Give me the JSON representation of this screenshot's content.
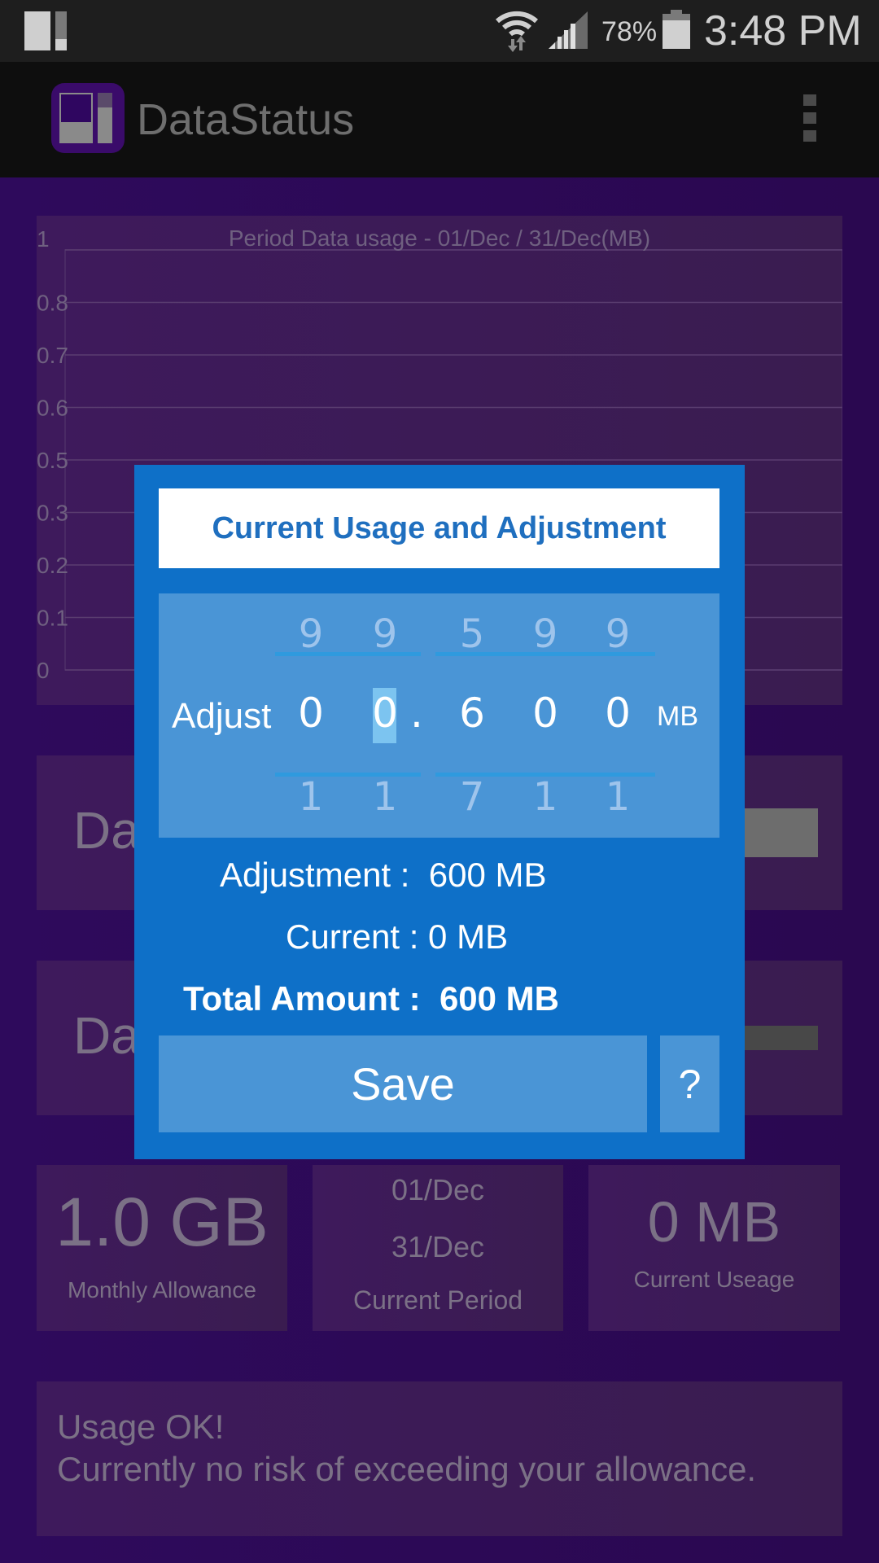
{
  "status_bar": {
    "battery_percent": "78%",
    "time": "3:48 PM",
    "icons": [
      "app-notification-icon",
      "wifi-icon",
      "signal-icon",
      "battery-icon"
    ]
  },
  "app_bar": {
    "title": "DataStatus",
    "overflow_icon": "more-vertical-icon"
  },
  "chart_data": {
    "type": "bar",
    "title": "Period Data usage - 01/Dec / 31/Dec(MB)",
    "ytick_labels": [
      "1",
      "0.8",
      "0.7",
      "0.6",
      "0.5",
      "0.3",
      "0.2",
      "0.1",
      "0"
    ],
    "ylim": [
      0,
      1
    ],
    "categories": [],
    "values": [],
    "grid": true,
    "xlabel": "",
    "ylabel": ""
  },
  "daily_cards": [
    {
      "label_partial": "Da",
      "bar_color": "#6d6d6d"
    },
    {
      "label_partial": "Da",
      "bar_color": "#484848"
    }
  ],
  "stats": [
    {
      "value": "1.0 GB",
      "label": "Monthly Allowance"
    },
    {
      "start": "01/Dec",
      "end": "31/Dec",
      "label": "Current Period"
    },
    {
      "value": "0 MB",
      "label": "Current Useage"
    }
  ],
  "message": {
    "line1": "Usage OK!",
    "line2": "Currently no risk of exceeding your allowance."
  },
  "dialog": {
    "title": "Current Usage and Adjustment",
    "adjust_label": "Adjust",
    "unit": "MB",
    "decimal": ".",
    "picker": {
      "above": [
        "9",
        "9",
        "5",
        "9",
        "9"
      ],
      "current": [
        "0",
        "0",
        "6",
        "0",
        "0"
      ],
      "below": [
        "1",
        "1",
        "7",
        "1",
        "1"
      ],
      "focused_index": 1
    },
    "adjustment_line": "Adjustment :  600 MB",
    "current_line": "Current : 0 MB",
    "total_line": "Total Amount :  600 MB",
    "save_label": "Save",
    "help_label": "?"
  },
  "colors": {
    "background": "#2b0856",
    "dialog": "#0e70c8",
    "dialog_panel": "#4a95d6",
    "title_text": "#1f6fbf",
    "picker_highlight": "#7cc4f0"
  }
}
